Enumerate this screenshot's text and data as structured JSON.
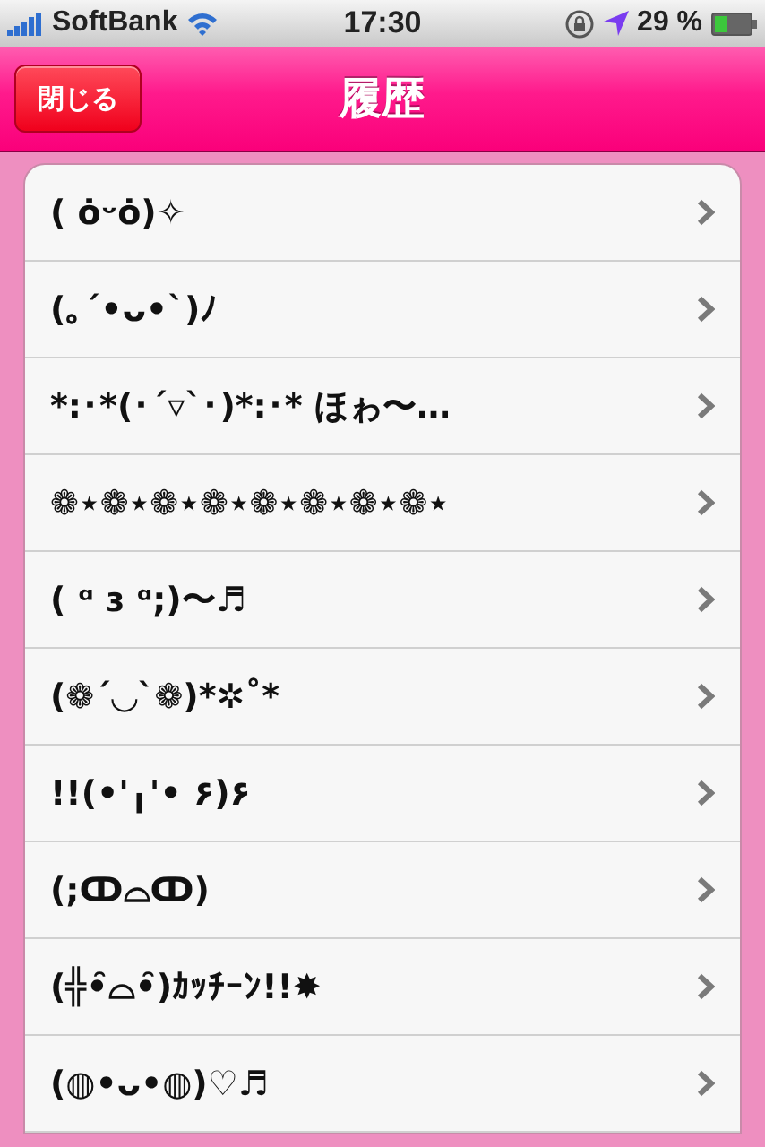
{
  "status_bar": {
    "carrier": "SoftBank",
    "time": "17:30",
    "battery": "29 %"
  },
  "nav_bar": {
    "close_button": "閉じる",
    "title": "履歴"
  },
  "history": [
    {
      "text": "( ȯᵕȯ)✧"
    },
    {
      "text": "(｡´•ᴗ•`)ﾉ"
    },
    {
      "text": "*:･*(･´▿`･)*:･* ほゎ〜…"
    },
    {
      "text": "❁⋆❁⋆❁⋆❁⋆❁⋆❁⋆❁⋆❁⋆"
    },
    {
      "text": "( ᵅ ɜ ᵅ;)〜♬"
    },
    {
      "text": "(❁´◡`❁)*✲˚*"
    },
    {
      "text": "!!(•'╻'• ۶)۶"
    },
    {
      "text": "(;ↀ⌓ↀ)"
    },
    {
      "text": "(╬•̑⌓•̑)ｶｯﾁｰﾝ!!✸"
    },
    {
      "text": "(◍•ᴗ•◍)♡♬"
    }
  ]
}
